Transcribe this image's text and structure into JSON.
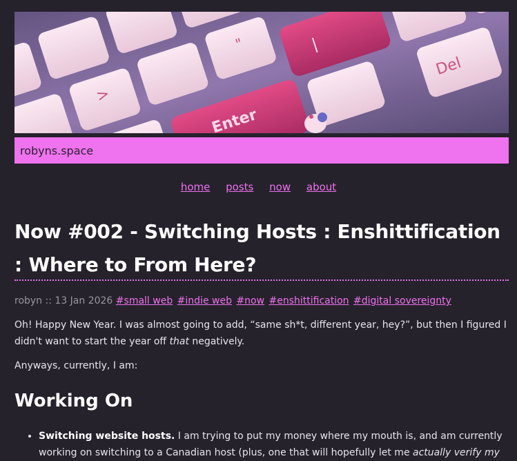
{
  "site": {
    "title": "robyns.space"
  },
  "banner": {
    "alt_keys": {
      "enter": "Enter",
      "del": "Del"
    }
  },
  "nav": {
    "items": [
      "home",
      "posts",
      "now",
      "about"
    ]
  },
  "post": {
    "title": "Now #002 - Switching Hosts : Enshittification : Where to From Here?",
    "author": "robyn",
    "separator": "::",
    "date": "13 Jan 2026",
    "tags": [
      "#small web",
      "#indie web",
      "#now",
      "#enshittification",
      "#digital sovereignty"
    ],
    "intro_before": "Oh! Happy New Year. I was almost going to add, “same sh*t, different year, hey?”, but then I figured I didn't want to start the year off ",
    "intro_em": "that",
    "intro_after": " negatively.",
    "para2": "Anyways, currently, I am:",
    "section_heading": "Working On",
    "list": [
      {
        "strong": "Switching website hosts.",
        "text": " I am trying to put my money where my mouth is, and am currently working on switching to a Canadian host (plus, one that will hopefully let me ",
        "em": "actually verify my"
      }
    ]
  },
  "colors": {
    "background": "#25222c",
    "accent": "#ef72ee",
    "text": "#e8e6ec",
    "muted": "#9a96a3"
  }
}
